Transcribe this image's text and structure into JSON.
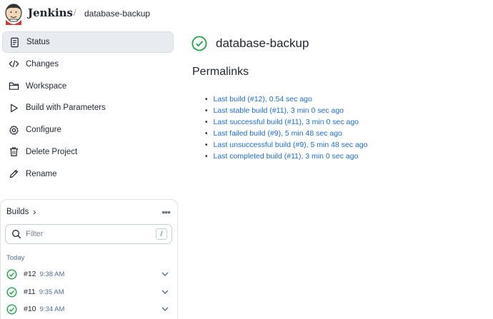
{
  "header": {
    "brand": "Jenkins",
    "separator": "/",
    "breadcrumb": "database-backup"
  },
  "nav": {
    "items": [
      {
        "label": "Status",
        "icon": "document-icon",
        "active": true
      },
      {
        "label": "Changes",
        "icon": "code-icon"
      },
      {
        "label": "Workspace",
        "icon": "folder-icon"
      },
      {
        "label": "Build with Parameters",
        "icon": "play-icon"
      },
      {
        "label": "Configure",
        "icon": "gear-icon"
      },
      {
        "label": "Delete Project",
        "icon": "trash-icon"
      },
      {
        "label": "Rename",
        "icon": "pencil-icon"
      }
    ]
  },
  "builds": {
    "title": "Builds",
    "filter_placeholder": "Filter",
    "filter_shortcut": "/",
    "group": "Today",
    "rows": [
      {
        "number": "#12",
        "time": "9:38 AM"
      },
      {
        "number": "#11",
        "time": "9:35 AM"
      },
      {
        "number": "#10",
        "time": "9:34 AM"
      }
    ]
  },
  "main": {
    "title": "database-backup",
    "section_title": "Permalinks",
    "permalinks": [
      "Last build (#12), 0.54 sec ago",
      "Last stable build (#11), 3 min 0 sec ago",
      "Last successful build (#11), 3 min 0 sec ago",
      "Last failed build (#9), 5 min 48 sec ago",
      "Last unsuccessful build (#9), 5 min 48 sec ago",
      "Last completed build (#11), 3 min 0 sec ago"
    ]
  },
  "colors": {
    "success": "#1ea446",
    "link": "#1f6cc2",
    "active_bg": "#e8ebef"
  }
}
